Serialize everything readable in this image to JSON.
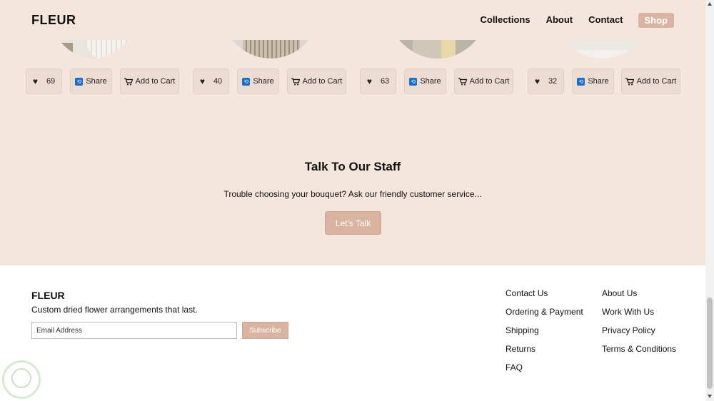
{
  "header": {
    "logo": "FLEUR",
    "nav": [
      "Collections",
      "About",
      "Contact"
    ],
    "shop_label": "Shop"
  },
  "products": [
    {
      "likes": "69",
      "share": "Share",
      "cart": "Add to Cart"
    },
    {
      "likes": "40",
      "share": "Share",
      "cart": "Add to Cart"
    },
    {
      "likes": "63",
      "share": "Share",
      "cart": "Add to Cart"
    },
    {
      "likes": "32",
      "share": "Share",
      "cart": "Add to Cart"
    }
  ],
  "talk": {
    "title": "Talk To Our Staff",
    "text": "Trouble choosing your bouquet? Ask our friendly customer service...",
    "button": "Let's Talk"
  },
  "footer": {
    "logo": "FLEUR",
    "tagline": "Custom dried flower arrangements that last.",
    "email_placeholder": "Email Address",
    "subscribe": "Subscribe",
    "links_col1": [
      "Contact Us",
      "Ordering & Payment",
      "Shipping",
      "Returns",
      "FAQ"
    ],
    "links_col2": [
      "About Us",
      "Work With Us",
      "Privacy Policy",
      "Terms & Conditions"
    ]
  },
  "colors": {
    "pink_bg": "#f5e6dd",
    "accent": "#d9b4a0",
    "button_bg": "#ecdcd2"
  }
}
